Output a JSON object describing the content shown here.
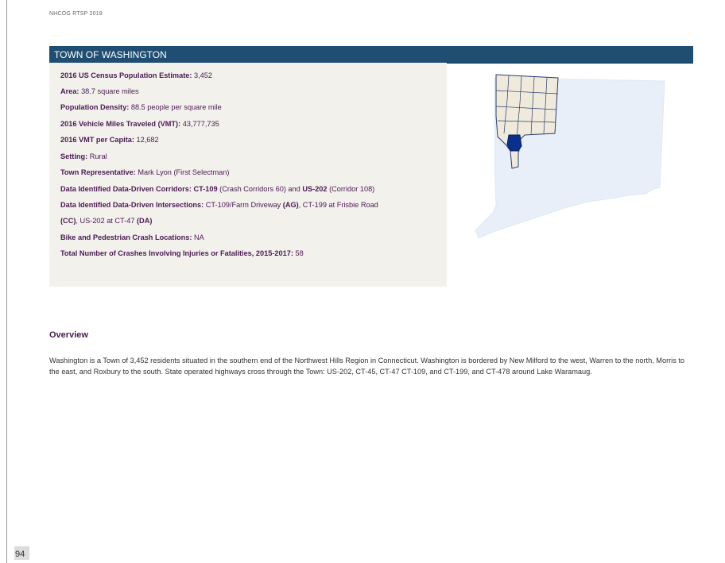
{
  "header": {
    "doc_label": "NHCOG RTSP 2018"
  },
  "title_bar": {
    "title": "TOWN OF WASHINGTON"
  },
  "town_profile": {
    "population_label": "2016 US Census Population Estimate:",
    "population_value": "3,452",
    "area_label": "Area:",
    "area_value": "38.7 square miles",
    "density_label": "Population Density:",
    "density_value": "88.5 people per square mile",
    "vmt_label": "2016 Vehicle Miles Traveled (VMT):",
    "vmt_value": "43,777,735",
    "vmt_capita_label": "2016 VMT per Capita:",
    "vmt_capita_value": "12,682",
    "setting_label": "Setting:",
    "setting_value": "Rural",
    "rep_label": "Town Representative:",
    "rep_value": "Mark Lyon (First Selectman)",
    "corridors_label": "Data Identified Data-Driven Corridors:",
    "corridor_1_name": "CT-109",
    "corridor_1_note": "(Crash Corridors 60) and",
    "corridor_2_name": "US-202",
    "corridor_2_note": "(Corridor 108)",
    "intersections_label": "Data Identified Data-Driven Intersections:",
    "intersection_1": "CT-109/Farm Driveway",
    "intersection_1_code": "(AG)",
    "intersection_2": ", CT-199 at Frisbie Road",
    "intersection_2_code": "(CC)",
    "intersection_3": ", US-202 at CT-47",
    "intersection_3_code": "(DA)",
    "bike_label": "Bike and Pedestrian Crash Locations:",
    "bike_value": "NA",
    "crashes_label": "Total Number of Crashes Involving Injuries or Fatalities, 2015-2017:",
    "crashes_value": "58"
  },
  "overview": {
    "heading": "Overview",
    "body": "Washington is a Town of 3,452 residents situated in the southern end of the Northwest Hills Region in Connecticut. Washington is bordered by New Milford to the west, Warren to the north, Morris to the east, and Roxbury to the south. State operated highways cross through the Town: US-202, CT-45, CT-47 CT-109, and CT-199, and CT-478 around Lake Waramaug."
  },
  "footer": {
    "page_number": "94"
  },
  "colors": {
    "title_bar": "#1f4e72",
    "label_text": "#4b1a52",
    "info_bg": "#f2f1ec",
    "map_highlight": "#0a2f8c",
    "map_region": "#efeadb",
    "map_state": "#e8eff8"
  }
}
